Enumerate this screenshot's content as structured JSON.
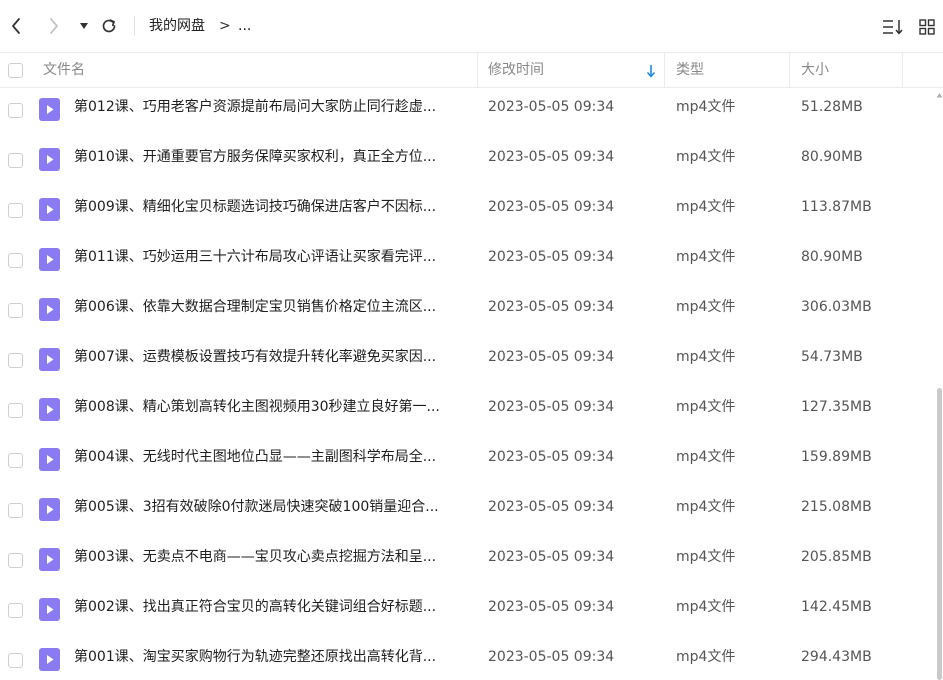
{
  "breadcrumb": {
    "root": "我的网盘",
    "separator": ">",
    "more": "..."
  },
  "header": {
    "name": "文件名",
    "modified": "修改时间",
    "type": "类型",
    "size": "大小"
  },
  "colors": {
    "accent": "#1e88e5",
    "file_icon": "#8a7bf2"
  },
  "icons": {
    "back": "chevron-left-icon",
    "forward": "chevron-right-icon",
    "dropdown": "caret-down-icon",
    "refresh": "refresh-icon",
    "sort": "sort-icon",
    "grid": "grid-view-icon",
    "file": "video-file-icon"
  },
  "files": [
    {
      "name": "第012课、巧用老客户资源提前布局问大家防止同行趁虚...",
      "modified": "2023-05-05 09:34",
      "type": "mp4文件",
      "size": "51.28MB"
    },
    {
      "name": "第010课、开通重要官方服务保障买家权利，真正全方位...",
      "modified": "2023-05-05 09:34",
      "type": "mp4文件",
      "size": "80.90MB"
    },
    {
      "name": "第009课、精细化宝贝标题选词技巧确保进店客户不因标...",
      "modified": "2023-05-05 09:34",
      "type": "mp4文件",
      "size": "113.87MB"
    },
    {
      "name": "第011课、巧妙运用三十六计布局攻心评语让买家看完评...",
      "modified": "2023-05-05 09:34",
      "type": "mp4文件",
      "size": "80.90MB"
    },
    {
      "name": "第006课、依靠大数据合理制定宝贝销售价格定位主流区...",
      "modified": "2023-05-05 09:34",
      "type": "mp4文件",
      "size": "306.03MB"
    },
    {
      "name": "第007课、运费模板设置技巧有效提升转化率避免买家因...",
      "modified": "2023-05-05 09:34",
      "type": "mp4文件",
      "size": "54.73MB"
    },
    {
      "name": "第008课、精心策划高转化主图视频用30秒建立良好第一...",
      "modified": "2023-05-05 09:34",
      "type": "mp4文件",
      "size": "127.35MB"
    },
    {
      "name": "第004课、无线时代主图地位凸显——主副图科学布局全...",
      "modified": "2023-05-05 09:34",
      "type": "mp4文件",
      "size": "159.89MB"
    },
    {
      "name": "第005课、3招有效破除0付款迷局快速突破100销量迎合...",
      "modified": "2023-05-05 09:34",
      "type": "mp4文件",
      "size": "215.08MB"
    },
    {
      "name": "第003课、无卖点不电商——宝贝攻心卖点挖掘方法和呈...",
      "modified": "2023-05-05 09:34",
      "type": "mp4文件",
      "size": "205.85MB"
    },
    {
      "name": "第002课、找出真正符合宝贝的高转化关键词组合好标题...",
      "modified": "2023-05-05 09:34",
      "type": "mp4文件",
      "size": "142.45MB"
    },
    {
      "name": "第001课、淘宝买家购物行为轨迹完整还原找出高转化背...",
      "modified": "2023-05-05 09:34",
      "type": "mp4文件",
      "size": "294.43MB"
    }
  ]
}
